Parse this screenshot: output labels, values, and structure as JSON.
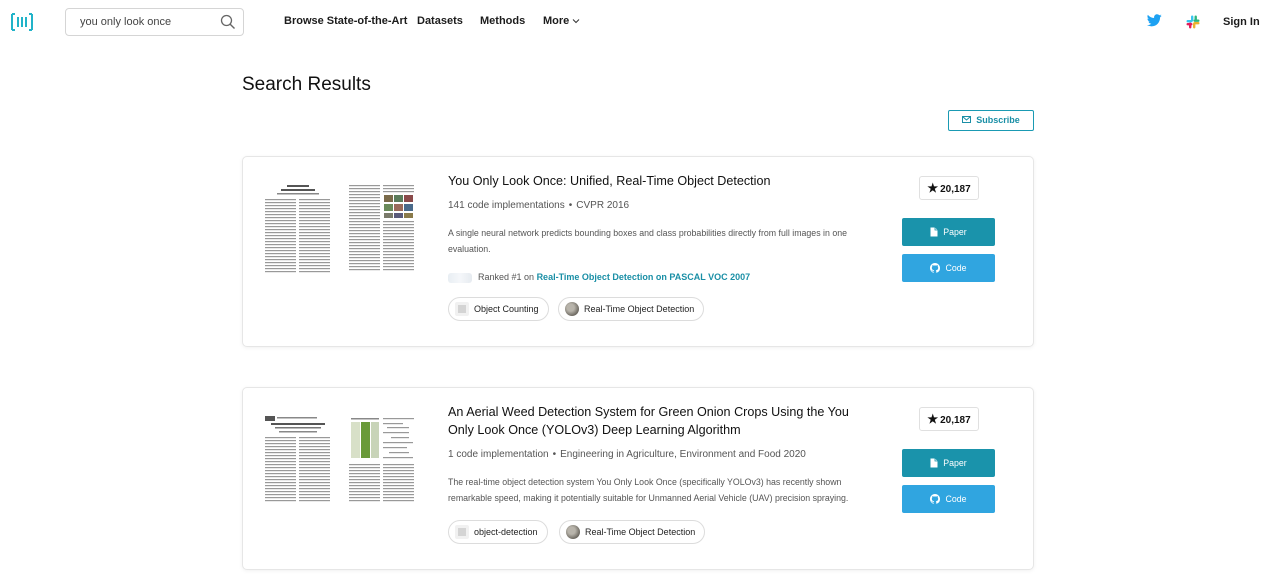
{
  "nav": {
    "search_value": "you only look once",
    "links": [
      "Browse State-of-the-Art",
      "Datasets",
      "Methods",
      "More"
    ],
    "sign_in": "Sign In",
    "icons": [
      "logo-icon",
      "search-icon",
      "chevron-down-icon",
      "twitter-icon",
      "slack-icon"
    ]
  },
  "page": {
    "title": "Search Results",
    "subscribe": "Subscribe"
  },
  "results": [
    {
      "title": "You Only Look Once: Unified, Real-Time Object Detection",
      "implementations": "141 code implementations",
      "venue": "CVPR 2016",
      "abstract": "A single neural network predicts bounding boxes and class probabilities directly from full images in one evaluation.",
      "ranked_prefix": "Ranked #1 on",
      "ranked_link": "Real-Time Object Detection on PASCAL VOC 2007",
      "tags": [
        "Object Counting",
        "Real-Time Object Detection"
      ],
      "stars": "20,187",
      "paper_label": "Paper",
      "code_label": "Code"
    },
    {
      "title": "An Aerial Weed Detection System for Green Onion Crops Using the You Only Look Once (YOLOv3) Deep Learning Algorithm",
      "implementations": "1 code implementation",
      "venue": "Engineering in Agriculture, Environment and Food 2020",
      "abstract": "The real-time object detection system You Only Look Once (specifically YOLOv3) has recently shown remarkable speed, making it potentially suitable for Unmanned Aerial Vehicle (UAV) precision spraying.",
      "tags": [
        "object-detection",
        "Real-Time Object Detection"
      ],
      "stars": "20,187",
      "paper_label": "Paper",
      "code_label": "Code"
    }
  ],
  "colors": {
    "accent": "#1a93ab",
    "code_button": "#30a5e0",
    "twitter": "#1da1f2"
  }
}
